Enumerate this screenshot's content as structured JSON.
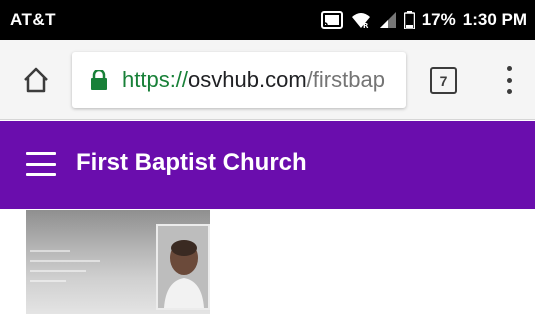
{
  "status_bar": {
    "carrier": "AT&T",
    "battery": "17%",
    "time": "1:30 PM",
    "icons": [
      "cast-icon",
      "wifi-calling-icon",
      "signal-icon",
      "battery-icon"
    ]
  },
  "browser": {
    "url_scheme": "https://",
    "url_domain": "osvhub.com",
    "url_path": "/firstbap",
    "tab_count": "7",
    "icons": [
      "home-icon",
      "lock-icon",
      "tab-switcher-icon",
      "more-options-icon"
    ]
  },
  "app_bar": {
    "title": "First Baptist Church",
    "icons": [
      "hamburger-menu-icon"
    ]
  },
  "colors": {
    "status_bar": "#000000",
    "browser_toolbar": "#f5f5f5",
    "app_bar": "#6a0dad",
    "lock": "#188038"
  }
}
